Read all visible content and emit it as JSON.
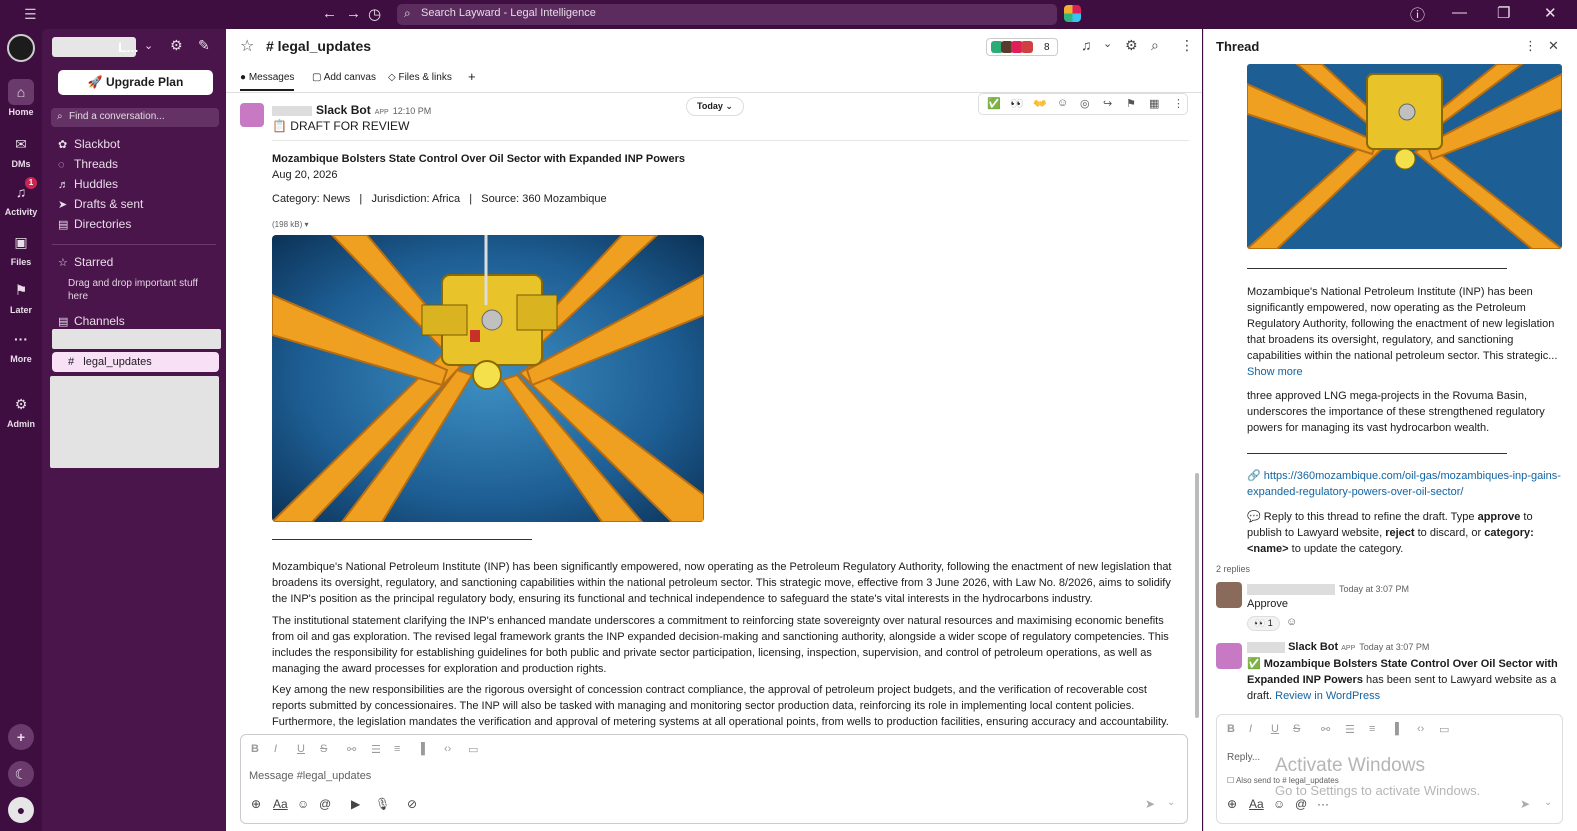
{
  "topbar": {
    "search_placeholder": "Search Layward - Legal Intelligence"
  },
  "rail": {
    "items": [
      {
        "label": "Home",
        "icon": "home-icon"
      },
      {
        "label": "DMs",
        "icon": "dms-icon"
      },
      {
        "label": "Activity",
        "icon": "bell-icon",
        "badge": "1"
      },
      {
        "label": "Files",
        "icon": "files-icon"
      },
      {
        "label": "Later",
        "icon": "bookmark-icon"
      },
      {
        "label": "More",
        "icon": "more-icon"
      },
      {
        "label": "Admin",
        "icon": "gear-icon"
      }
    ]
  },
  "sidebar": {
    "workspace_suffix": "L...",
    "upgrade_label": "Upgrade Plan",
    "find_placeholder": "Find a conversation...",
    "nav": [
      "Slackbot",
      "Threads",
      "Huddles",
      "Drafts & sent",
      "Directories"
    ],
    "starred_label": "Starred",
    "starred_note": "Drag and drop important stuff here",
    "channels_label": "Channels",
    "selected_channel": "legal_updates"
  },
  "channel": {
    "name": "# legal_updates",
    "member_count": "8",
    "tabs": [
      "Messages",
      "Add canvas",
      "Files & links"
    ]
  },
  "message": {
    "sender": "Slack Bot",
    "app_tag": "APP",
    "time": "12:10 PM",
    "today_label": "Today",
    "draft_label": "📋 DRAFT FOR REVIEW",
    "title": "Mozambique Bolsters State Control Over Oil Sector with Expanded INP Powers",
    "date": "Aug 20, 2026",
    "meta": "Category: News   |   Jurisdiction: Africa   |   Source: 360 Mozambique",
    "file_size": "(198 kB) ▾",
    "paragraphs": [
      "Mozambique's National Petroleum Institute (INP) has been significantly empowered, now operating as the Petroleum Regulatory Authority, following the enactment of new legislation that broadens its oversight, regulatory, and sanctioning capabilities within the national petroleum sector. This strategic move, effective from 3 June 2026, with Law No. 8/2026, aims to solidify the INP's position as the principal regulatory body, ensuring its functional and technical independence to safeguard the state's vital interests in the hydrocarbons industry.",
      "The institutional statement clarifying the INP's enhanced mandate underscores a commitment to reinforcing state sovereignty over natural resources and maximising economic benefits from oil and gas exploration. The revised legal framework grants the INP expanded decision-making and sanctioning authority, alongside a wider scope of regulatory competencies. This includes the responsibility for establishing guidelines for both public and private sector participation, licensing, inspection, supervision, and control of petroleum operations, as well as managing the award processes for exploration and production rights.",
      "Key among the new responsibilities are the rigorous oversight of concession contract compliance, the approval of petroleum project budgets, and the verification of recoverable cost reports submitted by concessionaires. The INP will also be tasked with managing and monitoring sector production data, reinforcing its role in implementing local content policies. Furthermore, the legislation mandates the verification and approval of metering systems at all operational points, from wells to production facilities, ensuring accuracy and accountability."
    ]
  },
  "composer": {
    "placeholder": "Message #legal_updates"
  },
  "thread": {
    "title": "Thread",
    "summary": "Mozambique's National Petroleum Institute (INP) has been significantly empowered, now operating as the Petroleum Regulatory Authority, following the enactment of new legislation that broadens its oversight, regulatory, and sanctioning capabilities within the national petroleum sector. This strategic...",
    "show_more": "Show more",
    "tail": "three approved LNG mega-projects in the Rovuma Basin, underscores the importance of these strengthened regulatory powers for managing its vast hydrocarbon wealth.",
    "url": "https://360mozambique.com/oil-gas/mozambiques-inp-gains-expanded-regulatory-powers-over-oil-sector/",
    "instructions_pre": "Reply to this thread to refine the draft. Type ",
    "kw_approve": "approve",
    "instructions_mid1": " to publish to Lawyard website, ",
    "kw_reject": "reject",
    "instructions_mid2": " to discard, or ",
    "kw_category": "category: <name>",
    "instructions_post": " to update the category.",
    "reply_count": "2 replies",
    "reply1_time": "Today at 3:07 PM",
    "reply1_text": "Approve",
    "reply1_reaction": "👀 1",
    "reply2_sender": "Slack Bot",
    "reply2_app": "APP",
    "reply2_time": "Today at 3:07 PM",
    "reply2_bold": "Mozambique Bolsters State Control Over Oil Sector with Expanded INP Powers",
    "reply2_rest": " has been sent to Lawyard website as a draft. ",
    "reply2_link": "Review in WordPress",
    "reply_placeholder": "Reply...",
    "also_send": "Also send to # legal_updates"
  },
  "watermark": {
    "line1": "Activate Windows",
    "line2": "Go to Settings to activate Windows."
  },
  "colors": {
    "aubergine": "#3f0e40",
    "sidebar": "#4a154b",
    "link": "#1264a3"
  }
}
